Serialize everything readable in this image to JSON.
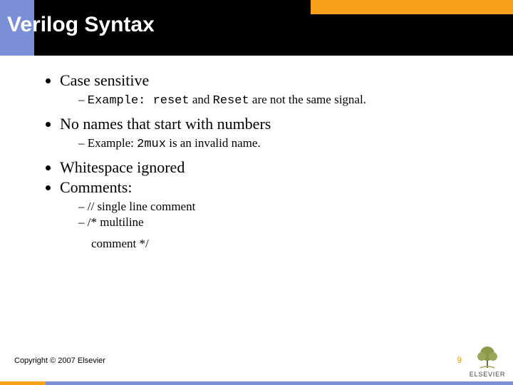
{
  "title": "Verilog Syntax",
  "bullets": {
    "b1": {
      "text": "Case sensitive"
    },
    "b1s": {
      "prefix": "Example: ",
      "code1": "reset",
      "mid": " and ",
      "code2": "Reset",
      "suffix": " are not the same signal."
    },
    "b2": {
      "text": "No names that start with numbers"
    },
    "b2s": {
      "prefix": "Example: ",
      "code": "2mux",
      "suffix": " is an invalid name."
    },
    "b3": {
      "text": "Whitespace ignored"
    },
    "b4": {
      "text": "Comments:"
    },
    "b4s1": "// single line comment",
    "b4s2": "/* multiline",
    "b4s2b": "comment */"
  },
  "footer": {
    "copyright": "Copyright © 2007 Elsevier",
    "page": "9",
    "logo_text": "ELSEVIER"
  }
}
